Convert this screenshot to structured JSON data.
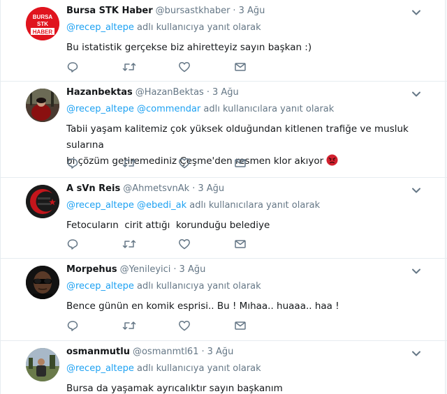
{
  "tweets": [
    {
      "name": "Bursa STK Haber",
      "handle": "@bursastkhaber",
      "dot": "·",
      "time": "3 Ağu",
      "mentions": [
        "@recep_altepe"
      ],
      "reply_suffix": "adlı kullanıcıya yanıt olarak",
      "text": "Bu istatistik gerçekse biz ahiretteyiz sayın başkan :)",
      "avatar_lines": [
        "BURSA",
        "STK",
        "HABER"
      ]
    },
    {
      "name": "Hazanbektas",
      "handle": "@HazanBektas",
      "dot": "·",
      "time": "3 Ağu",
      "mentions": [
        "@recep_altepe",
        "@commendar"
      ],
      "reply_suffix": "adlı kullanıcılara yanıt olarak",
      "text_line1": "Tabii yaşam kalitemiz çok yüksek olduğundan kitlenen trafiğe ve musluk sularına",
      "text_line2": "bi çözüm getiremediniz Çeşme'den resmen klor akıyor"
    },
    {
      "name": "A sVn Reis",
      "handle": "@AhmetsvnAk",
      "dot": "·",
      "time": "3 Ağu",
      "mentions": [
        "@recep_altepe",
        "@ebedi_ak"
      ],
      "reply_suffix": "adlı kullanıcılara yanıt olarak",
      "text": "Fetocuların  cirit attığı  korunduğu belediye"
    },
    {
      "name": "Morpehus",
      "handle": "@Yenileyici",
      "dot": "·",
      "time": "3 Ağu",
      "mentions": [
        "@recep_altepe"
      ],
      "reply_suffix": "adlı kullanıcıya yanıt olarak",
      "text": "Bence günün en komik esprisi.. Bu ! Mıhaa.. huaaa.. haa !"
    },
    {
      "name": "osmanmutlu",
      "handle": "@osmanmtl61",
      "dot": "·",
      "time": "3 Ağu",
      "mentions": [
        "@recep_altepe"
      ],
      "reply_suffix": "adlı kullanıcıya yanıt olarak",
      "text": "Bursa da yaşamak ayrıcalıktır sayın başkanım"
    }
  ],
  "icons": {
    "reply": "reply-icon",
    "retweet": "retweet-icon",
    "like": "like-icon",
    "message": "direct-message-icon",
    "more": "chevron-down-icon"
  },
  "colors": {
    "mention": "#1da1f2",
    "secondary_text": "#657786",
    "icon": "#657786",
    "avatar_red": "#e0141e"
  }
}
